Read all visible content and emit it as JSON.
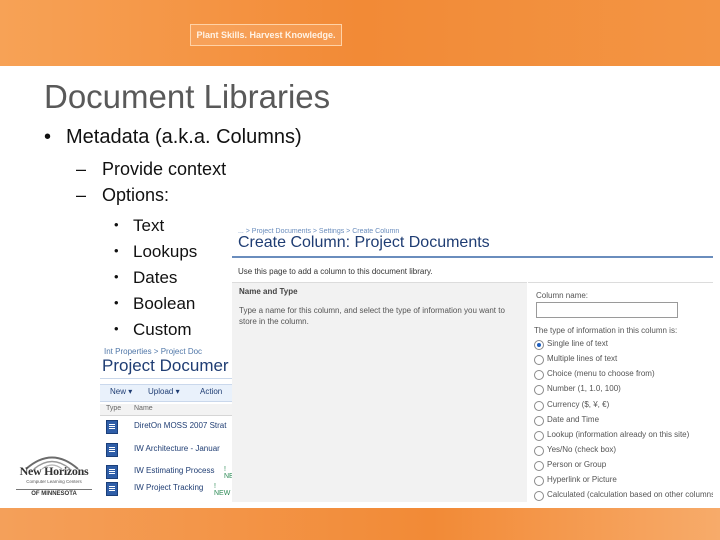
{
  "slide": {
    "tagline": "Plant Skills. Harvest Knowledge.",
    "title": "Document Libraries",
    "bullet": "Metadata (a.k.a. Columns)",
    "sub_bullets": [
      "Provide context",
      "Options:"
    ],
    "options": [
      "Text",
      "Lookups",
      "Dates",
      "Boolean",
      "Custom"
    ]
  },
  "logo": {
    "name": "New Horizons",
    "subtitle": "Computer Learning Centers",
    "state": "OF MINNESOTA",
    "colors": {
      "ring": "#6b6b6b",
      "text": "#333333"
    }
  },
  "library": {
    "breadcrumb": "Int Properties > Project Doc",
    "title": "Project Documer",
    "toolbar": {
      "new": "New",
      "upload": "Upload",
      "actions": "Action"
    },
    "columns": {
      "type": "Type",
      "name": "Name"
    },
    "rows": [
      {
        "name": "DiretOn MOSS 2007 Strat",
        "new": ""
      },
      {
        "name": "IW Architecture - Januar",
        "new": ""
      },
      {
        "name": "IW Estimating Process",
        "new": "! NEW"
      },
      {
        "name": "IW Project Tracking",
        "new": "! NEW"
      }
    ]
  },
  "create_column": {
    "breadcrumb": "... > Project Documents > Settings > Create Column",
    "title": "Create Column: Project Documents",
    "instructions": "Use this page to add a column to this document library.",
    "section_title": "Name and Type",
    "section_desc": "Type a name for this column, and select the type of information you want to store in the column.",
    "column_name_label": "Column name:",
    "column_name_value": "",
    "type_label": "The type of information in this column is:",
    "types": [
      {
        "label": "Single line of text",
        "selected": true
      },
      {
        "label": "Multiple lines of text",
        "selected": false
      },
      {
        "label": "Choice (menu to choose from)",
        "selected": false
      },
      {
        "label": "Number (1, 1.0, 100)",
        "selected": false
      },
      {
        "label": "Currency ($, ¥, €)",
        "selected": false
      },
      {
        "label": "Date and Time",
        "selected": false
      },
      {
        "label": "Lookup (information already on this site)",
        "selected": false
      },
      {
        "label": "Yes/No (check box)",
        "selected": false
      },
      {
        "label": "Person or Group",
        "selected": false
      },
      {
        "label": "Hyperlink or Picture",
        "selected": false
      },
      {
        "label": "Calculated (calculation based on other columns)",
        "selected": false
      }
    ]
  },
  "colors": {
    "banner": "#f28a36",
    "title_text": "#595959",
    "sharepoint_title": "#1f3d73",
    "sharepoint_link": "#5077a8"
  }
}
